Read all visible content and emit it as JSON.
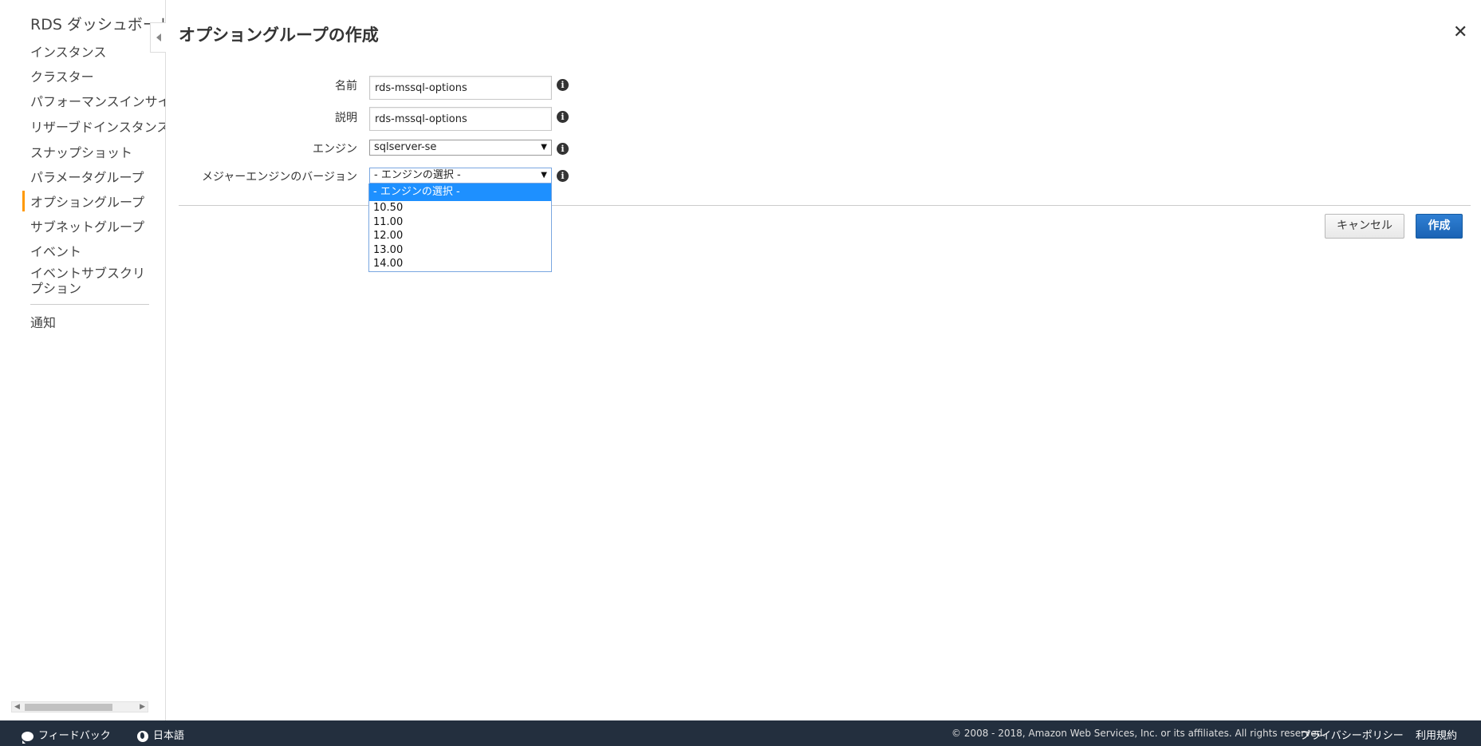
{
  "sidebar": {
    "title": "RDS ダッシュボード",
    "items": [
      {
        "label": "インスタンス"
      },
      {
        "label": "クラスター"
      },
      {
        "label": "パフォーマンスインサイト"
      },
      {
        "label": "リザーブドインスタンス"
      },
      {
        "label": "スナップショット"
      },
      {
        "label": "パラメータグループ"
      },
      {
        "label": "オプショングループ",
        "active": true
      },
      {
        "label": "サブネットグループ"
      },
      {
        "label": "イベント"
      },
      {
        "label": "イベントサブスクリプション"
      },
      {
        "label": "通知"
      }
    ]
  },
  "page": {
    "title": "オプショングループの作成"
  },
  "form": {
    "name": {
      "label": "名前",
      "value": "rds-mssql-options"
    },
    "description": {
      "label": "説明",
      "value": "rds-mssql-options"
    },
    "engine": {
      "label": "エンジン",
      "value": "sqlserver-se"
    },
    "version": {
      "label": "メジャーエンジンのバージョン",
      "value": "- エンジンの選択 -",
      "options": [
        "- エンジンの選択 -",
        "10.50",
        "11.00",
        "12.00",
        "13.00",
        "14.00"
      ],
      "highlighted_option": "- エンジンの選択 -"
    }
  },
  "buttons": {
    "cancel": "キャンセル",
    "create": "作成"
  },
  "footer": {
    "feedback": "フィードバック",
    "language": "日本語",
    "copyright": "© 2008 - 2018, Amazon Web Services, Inc. or its affiliates. All rights reserved.",
    "privacy": "プライバシーポリシー",
    "terms": "利用規約"
  },
  "colors": {
    "active_accent": "#ff9900",
    "primary_button": "#1a63b4",
    "dropdown_highlight": "#1e90ff",
    "footer_bg": "#232f3e"
  },
  "icons": [
    "collapse-left-icon",
    "close-icon",
    "info-icon",
    "dropdown-arrow-icon",
    "feedback-bubble-icon",
    "globe-icon"
  ]
}
